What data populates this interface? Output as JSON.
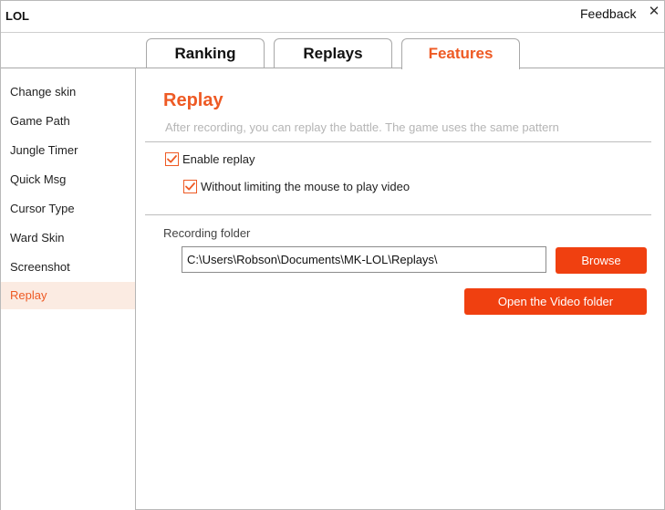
{
  "window": {
    "title": "LOL",
    "feedback_label": "Feedback",
    "close_glyph": "✕"
  },
  "tabs": [
    {
      "label": "Ranking",
      "active": false
    },
    {
      "label": "Replays",
      "active": false
    },
    {
      "label": "Features",
      "active": true
    }
  ],
  "sidebar": {
    "items": [
      {
        "label": "Change skin",
        "active": false
      },
      {
        "label": "Game Path",
        "active": false
      },
      {
        "label": "Jungle Timer",
        "active": false
      },
      {
        "label": "Quick Msg",
        "active": false
      },
      {
        "label": "Cursor Type",
        "active": false
      },
      {
        "label": "Ward Skin",
        "active": false
      },
      {
        "label": "Screenshot",
        "active": false
      },
      {
        "label": "Replay",
        "active": true
      }
    ]
  },
  "replay": {
    "title": "Replay",
    "description": "After recording, you can replay the battle. The game uses the same pattern",
    "enable_replay": {
      "label": "Enable replay",
      "checked": true
    },
    "unlimited_mouse": {
      "label": "Without limiting the mouse to play video",
      "checked": true
    },
    "folder_label": "Recording folder",
    "folder_path": "C:\\Users\\Robson\\Documents\\MK-LOL\\Replays\\",
    "browse_label": "Browse",
    "open_folder_label": "Open the Video folder"
  },
  "colors": {
    "accent": "#ee5a24",
    "button": "#f04010",
    "active_item_bg": "#fbebe2",
    "muted_text": "#b5b5b5"
  },
  "icons": {
    "checkbox_checked": "check-icon",
    "close": "close-icon"
  }
}
